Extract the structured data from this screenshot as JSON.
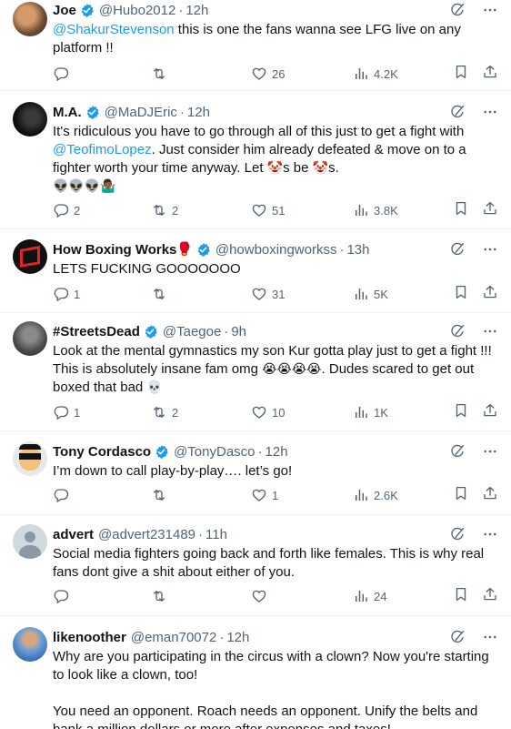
{
  "colors": {
    "text": "#0f1419",
    "muted": "#536471",
    "link": "#1d9bf0",
    "verified": "#1d9bf0",
    "divider": "#eff3f4"
  },
  "tweets": [
    {
      "name": "Joe",
      "handle": "@Hubo2012",
      "time": "12h",
      "verified": true,
      "text_parts": [
        {
          "type": "mention",
          "text": "@ShakurStevenson"
        },
        {
          "type": "text",
          "text": " this is one the fans wanna see LFG live on any platform !!"
        }
      ],
      "replies": "",
      "reposts": "",
      "likes": "26",
      "views": "4.2K"
    },
    {
      "name": "M.A.",
      "handle": "@MaDJEric",
      "time": "12h",
      "verified": true,
      "text_line1": "It's ridiculous you have to go through all of this just to get a fight with",
      "mention": "@TeofimoLopez",
      "text_line2": ". Just consider him already defeated & move on to a fighter worth your time anyway. Let ",
      "emoji_clown": "🤡",
      "text_mid": "s be ",
      "text_end": "s.",
      "emoji_row": "👽👽👽🤷🏾‍♂️",
      "replies": "2",
      "reposts": "2",
      "likes": "51",
      "views": "3.8K"
    },
    {
      "name": "How Boxing Works",
      "name_emoji": "🥊",
      "handle": "@howboxingworkss",
      "time": "13h",
      "verified": true,
      "text": "LETS FUCKING GOOOOOOO",
      "replies": "1",
      "reposts": "",
      "likes": "31",
      "views": "5K"
    },
    {
      "name": "#StreetsDead",
      "handle": "@Taegoe",
      "time": "9h",
      "verified": true,
      "text": "Look at the mental gymnastics my son Kur gotta play just to get a fight !!! This is absolutely insane fam omg ",
      "emoji_cry": "😭😭😭😭",
      "text2": ". Dudes scared to get out boxed that bad ",
      "emoji_skull": "💀",
      "replies": "1",
      "reposts": "2",
      "likes": "10",
      "views": "1K"
    },
    {
      "name": "Tony Cordasco",
      "handle": "@TonyDasco",
      "time": "12h",
      "verified": true,
      "text": "I’m down to call play-by-play…. let’s go!",
      "replies": "",
      "reposts": "",
      "likes": "1",
      "views": "2.6K"
    },
    {
      "name": "advert",
      "handle": "@advert231489",
      "time": "11h",
      "verified": false,
      "text": "Social media fighters going back and forth like females. This is why real fans dont give a shit about either of you.",
      "replies": "",
      "reposts": "",
      "likes": "",
      "views": "24"
    },
    {
      "name": "likenoother",
      "handle": "@eman70072",
      "time": "12h",
      "verified": false,
      "text": "Why are you participating in the circus with a clown? Now you're starting to look like a clown, too!",
      "text2": "You need an opponent. Roach needs an opponent. Unify the belts and bank a million dollars or more after expenses and taxes!"
    }
  ]
}
